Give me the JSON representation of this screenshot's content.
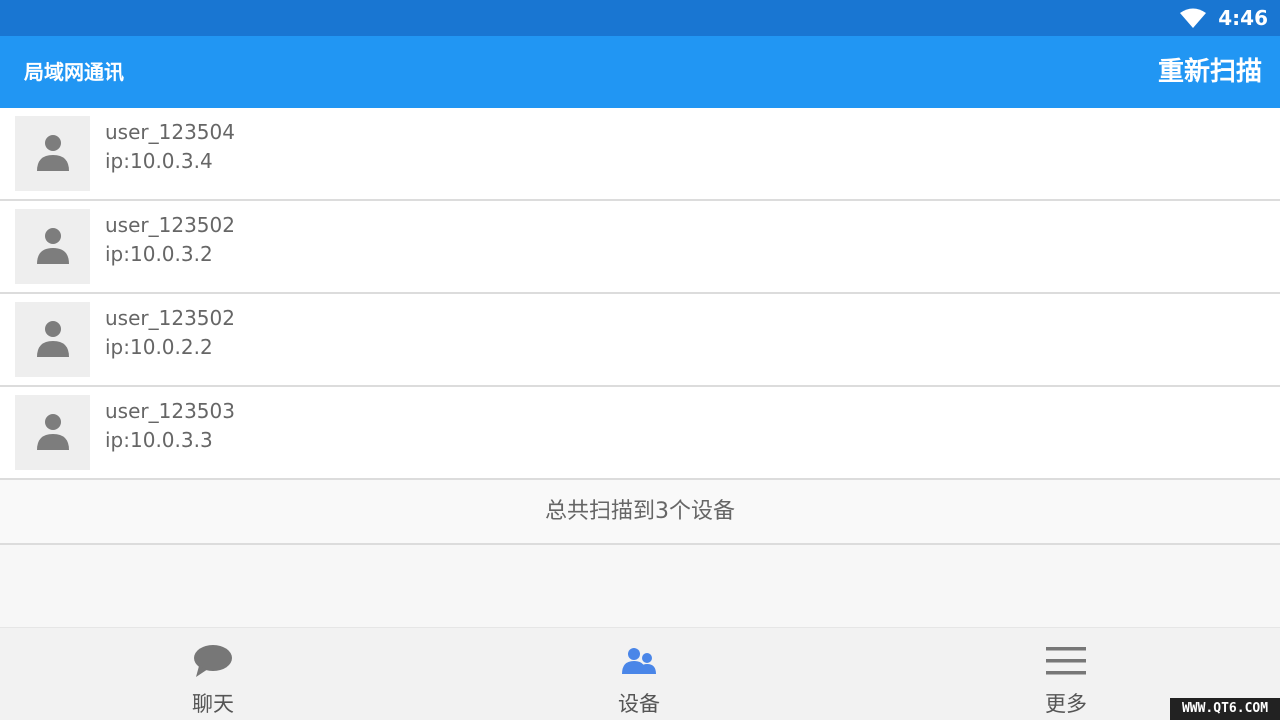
{
  "status_bar": {
    "time": "4:46",
    "icons": [
      "wifi-icon"
    ]
  },
  "app_bar": {
    "title": "局域网通讯",
    "rescan_label": "重新扫描"
  },
  "devices": [
    {
      "name": "user_123504",
      "ip": "ip:10.0.3.4",
      "icon": "person-icon"
    },
    {
      "name": "user_123502",
      "ip": "ip:10.0.3.2",
      "icon": "person-icon"
    },
    {
      "name": "user_123502",
      "ip": "ip:10.0.2.2",
      "icon": "person-icon"
    },
    {
      "name": "user_123503",
      "ip": "ip:10.0.3.3",
      "icon": "person-icon"
    }
  ],
  "summary": {
    "text": "总共扫描到3个设备"
  },
  "bottom_nav": {
    "items": [
      {
        "label": "聊天",
        "icon": "chat-bubble-icon",
        "active": false
      },
      {
        "label": "设备",
        "icon": "people-icon",
        "active": true
      },
      {
        "label": "更多",
        "icon": "menu-icon",
        "active": false
      }
    ]
  },
  "watermark": {
    "text": "WWW.QT6.COM"
  },
  "colors": {
    "status_bar": "#1976d2",
    "app_bar": "#2196f3",
    "active_icon": "#4a86e8",
    "inactive_icon": "#777777",
    "avatar_icon": "#7d7d7d"
  }
}
